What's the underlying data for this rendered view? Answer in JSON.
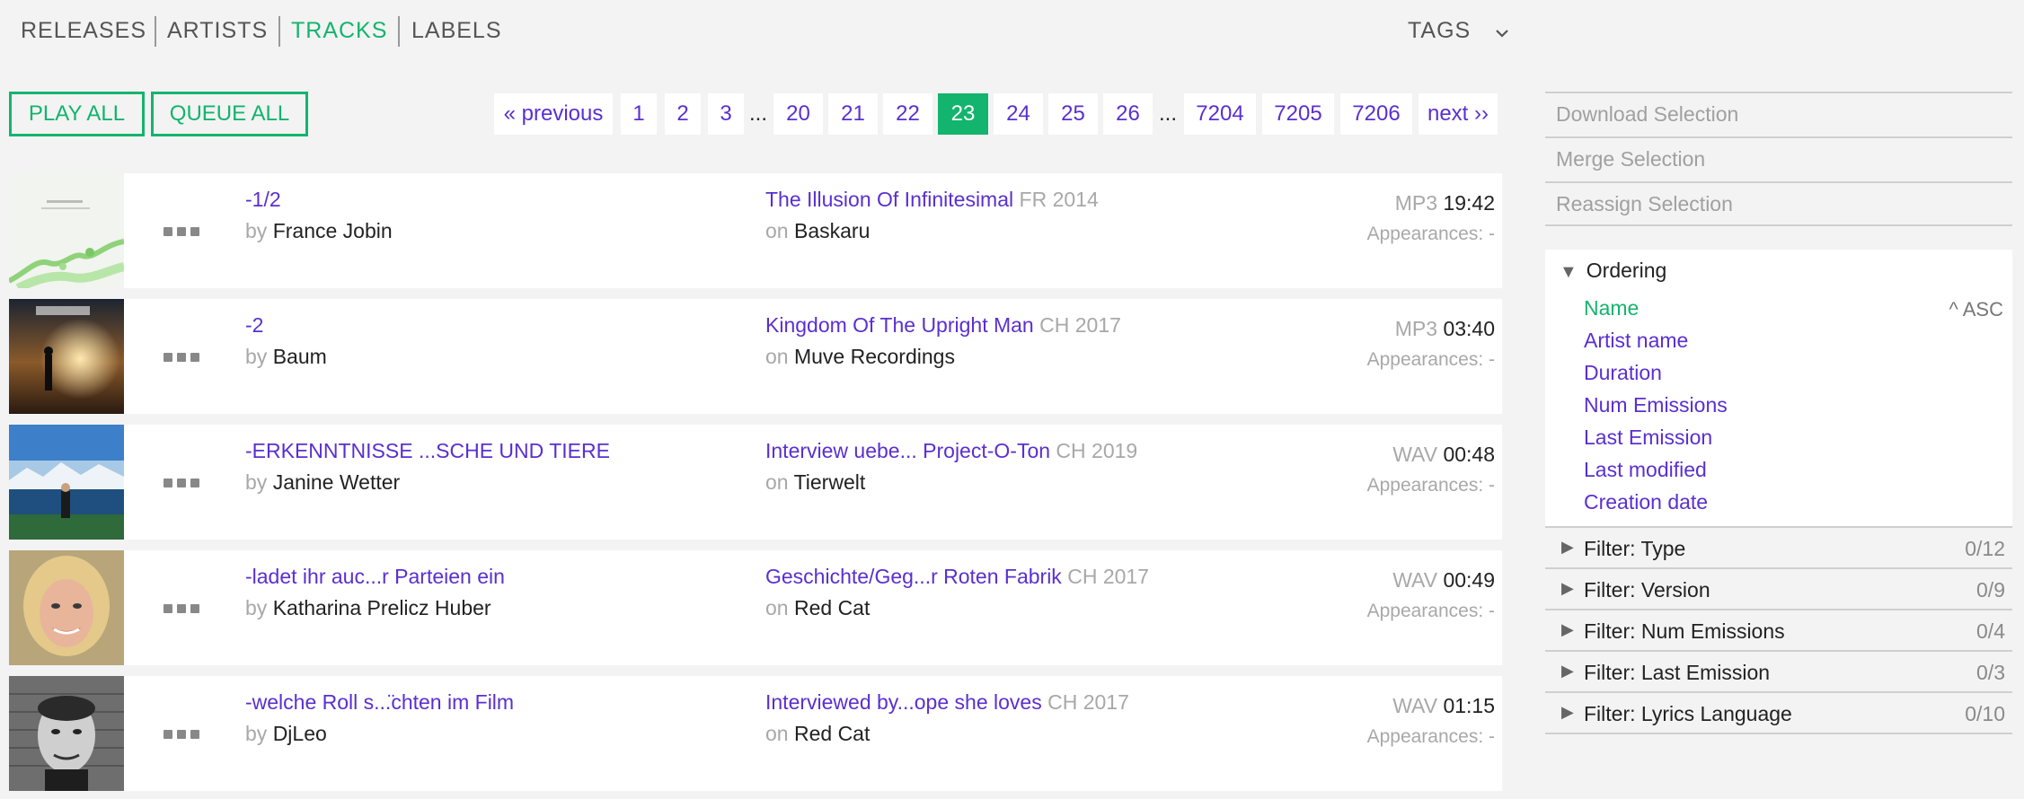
{
  "nav": {
    "items": [
      {
        "label": "RELEASES",
        "active": false
      },
      {
        "label": "ARTISTS",
        "active": false
      },
      {
        "label": "TRACKS",
        "active": true
      },
      {
        "label": "LABELS",
        "active": false
      }
    ],
    "tags_label": "TAGS",
    "tags_icon": "chevron-down-icon"
  },
  "actions": {
    "play_all": "PLAY ALL",
    "queue_all": "QUEUE ALL"
  },
  "pagination": {
    "previous": "« previous",
    "next": "next ››",
    "pages": [
      "1",
      "2",
      "3",
      "...",
      "20",
      "21",
      "22",
      "23",
      "24",
      "25",
      "26",
      "...",
      "7204",
      "7205",
      "7206"
    ],
    "current": "23"
  },
  "tracks": [
    {
      "title": "-1/2",
      "by_prefix": "by",
      "artist": "France Jobin",
      "release": "The Illusion Of Infinitesimal",
      "release_meta": "FR 2014",
      "on_prefix": "on",
      "label": "Baskaru",
      "format": "MP3",
      "duration": "19:42",
      "appearances": "Appearances: -"
    },
    {
      "title": "-2",
      "by_prefix": "by",
      "artist": "Baum",
      "release": "Kingdom Of The Upright Man",
      "release_meta": "CH 2017",
      "on_prefix": "on",
      "label": "Muve Recordings",
      "format": "MP3",
      "duration": "03:40",
      "appearances": "Appearances: -"
    },
    {
      "title": "-ERKENNTNISSE ...SCHE UND TIERE",
      "by_prefix": "by",
      "artist": "Janine Wetter",
      "release": "Interview uebe... Project-O-Ton",
      "release_meta": "CH 2019",
      "on_prefix": "on",
      "label": "Tierwelt",
      "format": "WAV",
      "duration": "00:48",
      "appearances": "Appearances: -"
    },
    {
      "title": "-ladet ihr auc...r Parteien ein",
      "by_prefix": "by",
      "artist": "Katharina Prelicz Huber",
      "release": "Geschichte/Geg...r Roten Fabrik",
      "release_meta": "CH 2017",
      "on_prefix": "on",
      "label": "Red Cat",
      "format": "WAV",
      "duration": "00:49",
      "appearances": "Appearances: -"
    },
    {
      "title": "-welche Roll s...̈chten im Film",
      "by_prefix": "by",
      "artist": "DjLeo",
      "release": "Interviewed by...ope she loves",
      "release_meta": "CH 2017",
      "on_prefix": "on",
      "label": "Red Cat",
      "format": "WAV",
      "duration": "01:15",
      "appearances": "Appearances: -"
    }
  ],
  "sidebar": {
    "actions": [
      "Download Selection",
      "Merge Selection",
      "Reassign Selection"
    ],
    "ordering": {
      "title": "Ordering",
      "items": [
        "Name",
        "Artist name",
        "Duration",
        "Num Emissions",
        "Last Emission",
        "Last modified",
        "Creation date"
      ],
      "active": "Name",
      "direction": "^ ASC"
    },
    "filters": [
      {
        "label": "Filter: Type",
        "count": "0/12"
      },
      {
        "label": "Filter: Version",
        "count": "0/9"
      },
      {
        "label": "Filter: Num Emissions",
        "count": "0/4"
      },
      {
        "label": "Filter: Last Emission",
        "count": "0/3"
      },
      {
        "label": "Filter: Lyrics Language",
        "count": "0/10"
      }
    ]
  },
  "colors": {
    "accent_green": "#13b46e",
    "link_purple": "#5a2fd0",
    "muted_gray": "#a8a8a8"
  }
}
